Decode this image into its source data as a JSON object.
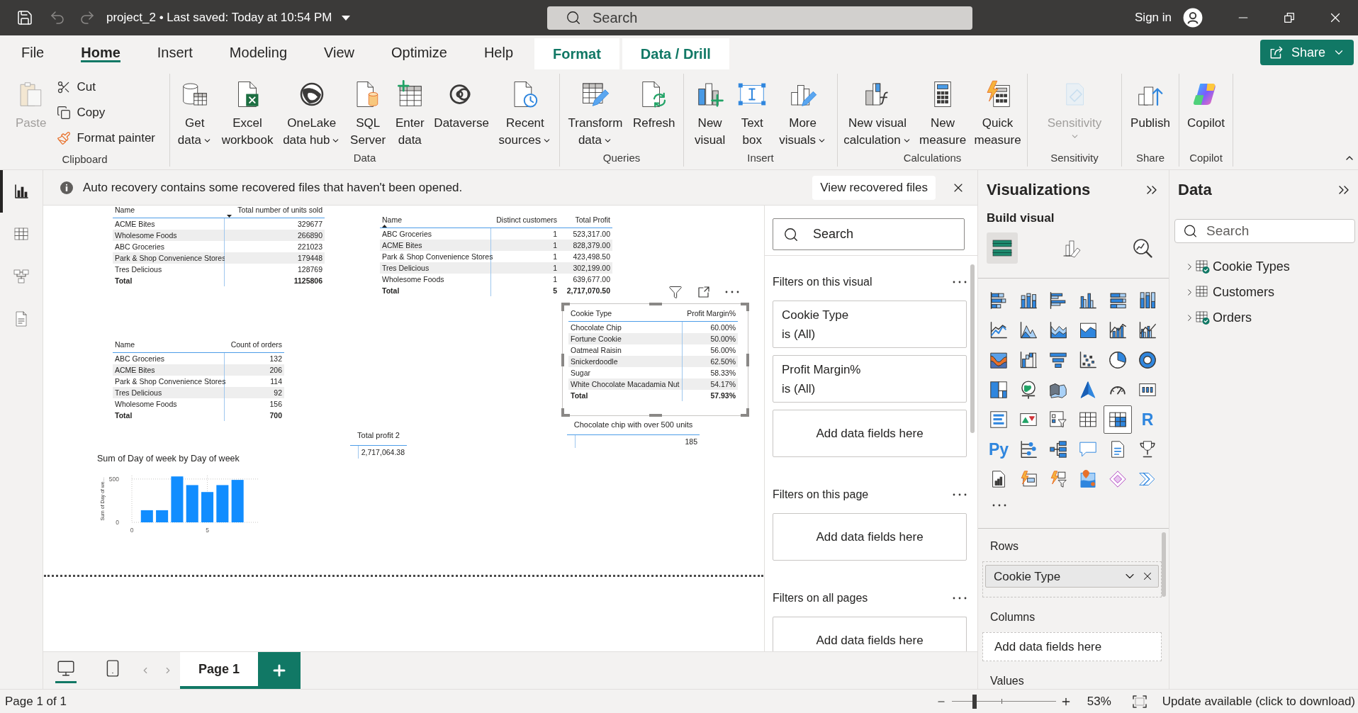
{
  "title_bar": {
    "title": "project_2 • Last saved: Today at 10:54 PM",
    "history": [
      {
        "kind": "undo",
        "disabled": true
      },
      {
        "kind": "redo",
        "disabled": true
      }
    ],
    "search": {
      "placeholder": "Search"
    },
    "sign_in": "Sign in"
  },
  "tabs": [
    {
      "label": "File",
      "selected": false,
      "contextual": false
    },
    {
      "label": "Home",
      "selected": true,
      "contextual": false
    },
    {
      "label": "Insert",
      "selected": false,
      "contextual": false
    },
    {
      "label": "Modeling",
      "selected": false,
      "contextual": false
    },
    {
      "label": "View",
      "selected": false,
      "contextual": false
    },
    {
      "label": "Optimize",
      "selected": false,
      "contextual": false
    },
    {
      "label": "Help",
      "selected": false,
      "contextual": false
    },
    {
      "label": "Format",
      "selected": false,
      "contextual": true
    },
    {
      "label": "Data / Drill",
      "selected": false,
      "contextual": true
    }
  ],
  "share_button": {
    "label": "Share"
  },
  "ribbon": [
    {
      "label": "Clipboard",
      "items": [
        {
          "kind": "large",
          "lines": [
            "Paste"
          ],
          "disabled": true,
          "dropdown": false
        },
        {
          "kind": "small",
          "lines": [
            "Cut"
          ],
          "disabled": false,
          "dropdown": false
        },
        {
          "kind": "small",
          "lines": [
            "Copy"
          ],
          "disabled": false,
          "dropdown": false
        },
        {
          "kind": "small",
          "lines": [
            "Format painter"
          ],
          "disabled": false,
          "dropdown": false
        }
      ]
    },
    {
      "label": "Data",
      "items": [
        {
          "kind": "large",
          "lines": [
            "Get",
            "data"
          ],
          "disabled": false,
          "dropdown": true
        },
        {
          "kind": "large",
          "lines": [
            "Excel",
            "workbook"
          ],
          "disabled": false,
          "dropdown": false
        },
        {
          "kind": "large",
          "lines": [
            "OneLake",
            "data hub"
          ],
          "disabled": false,
          "dropdown": true
        },
        {
          "kind": "large",
          "lines": [
            "SQL",
            "Server"
          ],
          "disabled": false,
          "dropdown": false
        },
        {
          "kind": "large",
          "lines": [
            "Enter",
            "data"
          ],
          "disabled": false,
          "dropdown": false
        },
        {
          "kind": "large",
          "lines": [
            "Dataverse"
          ],
          "disabled": false,
          "dropdown": false
        },
        {
          "kind": "large",
          "lines": [
            "Recent",
            "sources"
          ],
          "disabled": false,
          "dropdown": true
        }
      ]
    },
    {
      "label": "Queries",
      "items": [
        {
          "kind": "large",
          "lines": [
            "Transform",
            "data"
          ],
          "disabled": false,
          "dropdown": true
        },
        {
          "kind": "large",
          "lines": [
            "Refresh"
          ],
          "disabled": false,
          "dropdown": false
        }
      ]
    },
    {
      "label": "Insert",
      "items": [
        {
          "kind": "large",
          "lines": [
            "New",
            "visual"
          ],
          "disabled": false,
          "dropdown": false
        },
        {
          "kind": "large",
          "lines": [
            "Text",
            "box"
          ],
          "disabled": false,
          "dropdown": false
        },
        {
          "kind": "large",
          "lines": [
            "More",
            "visuals"
          ],
          "disabled": false,
          "dropdown": true
        }
      ]
    },
    {
      "label": "Calculations",
      "items": [
        {
          "kind": "large",
          "lines": [
            "New visual",
            "calculation"
          ],
          "disabled": false,
          "dropdown": true
        },
        {
          "kind": "large",
          "lines": [
            "New",
            "measure"
          ],
          "disabled": false,
          "dropdown": false
        },
        {
          "kind": "large",
          "lines": [
            "Quick",
            "measure"
          ],
          "disabled": false,
          "dropdown": false
        }
      ]
    },
    {
      "label": "Sensitivity",
      "items": [
        {
          "kind": "large",
          "lines": [
            "Sensitivity"
          ],
          "disabled": true,
          "dropdown": true
        }
      ]
    },
    {
      "label": "Share",
      "items": [
        {
          "kind": "large",
          "lines": [
            "Publish"
          ],
          "disabled": false,
          "dropdown": false
        }
      ]
    },
    {
      "label": "Copilot",
      "items": [
        {
          "kind": "large",
          "lines": [
            "Copilot"
          ],
          "disabled": false,
          "dropdown": false
        }
      ]
    }
  ],
  "notification": {
    "message": "Auto recovery contains some recovered files that haven't been opened.",
    "action": "View recovered files"
  },
  "left_nav": [
    {
      "selected": true
    },
    {
      "selected": false
    },
    {
      "selected": false
    },
    {
      "selected": false
    }
  ],
  "canvas": {
    "tables": [
      {
        "selected": false,
        "columns": [
          {
            "label": "Name",
            "sorted": false
          },
          {
            "label": "Total number of units sold",
            "sorted": true,
            "descending": true
          }
        ],
        "rows": [
          [
            "ACME Bites",
            "329677"
          ],
          [
            "Wholesome Foods",
            "266890"
          ],
          [
            "ABC Groceries",
            "221023"
          ],
          [
            "Park & Shop Convenience Stores",
            "179448"
          ],
          [
            "Tres Delicious",
            "128769"
          ]
        ],
        "total": [
          "Total",
          "1125806"
        ]
      },
      {
        "selected": false,
        "columns": [
          {
            "label": "Name",
            "sorted": true,
            "descending": false
          },
          {
            "label": "Distinct customers",
            "sorted": false
          },
          {
            "label": "Total Profit",
            "sorted": false
          }
        ],
        "rows": [
          [
            "ABC Groceries",
            "1",
            "523,317.00"
          ],
          [
            "ACME Bites",
            "1",
            "828,379.00"
          ],
          [
            "Park & Shop Convenience Stores",
            "1",
            "423,498.50"
          ],
          [
            "Tres Delicious",
            "1",
            "302,199.00"
          ],
          [
            "Wholesome Foods",
            "1",
            "639,677.00"
          ]
        ],
        "total": [
          "Total",
          "5",
          "2,717,070.50"
        ]
      },
      {
        "selected": false,
        "columns": [
          {
            "label": "Name",
            "sorted": false
          },
          {
            "label": "Count of orders",
            "sorted": false
          }
        ],
        "rows": [
          [
            "ABC Groceries",
            "132"
          ],
          [
            "ACME Bites",
            "206"
          ],
          [
            "Park & Shop Convenience Stores",
            "114"
          ],
          [
            "Tres Delicious",
            "92"
          ],
          [
            "Wholesome Foods",
            "156"
          ]
        ],
        "total": [
          "Total",
          "700"
        ]
      },
      {
        "selected": true,
        "columns": [
          {
            "label": "Cookie Type",
            "sorted": false
          },
          {
            "label": "Profit Margin%",
            "sorted": false
          }
        ],
        "rows": [
          [
            "Chocolate Chip",
            "60.00%"
          ],
          [
            "Fortune Cookie",
            "50.00%"
          ],
          [
            "Oatmeal Raisin",
            "56.00%"
          ],
          [
            "Snickerdoodle",
            "62.50%"
          ],
          [
            "Sugar",
            "58.33%"
          ],
          [
            "White Chocolate Macadamia Nut",
            "54.17%"
          ]
        ],
        "total": [
          "Total",
          "57.93%"
        ]
      }
    ],
    "cards": [
      {
        "label": "Total profit 2",
        "value": "2,717,064.38"
      },
      {
        "label": "Chocolate chip with over 500 units",
        "value": "185"
      }
    ],
    "chart": {
      "chart_data": {
        "type": "bar",
        "title": "Sum of Day of week by Day of week",
        "ylabel": "Sum of Day of we...",
        "x": [
          1,
          2,
          3,
          4,
          5,
          6,
          7
        ],
        "values": [
          140,
          140,
          530,
          430,
          350,
          430,
          490
        ],
        "color": "#118dff",
        "xticks": [
          0,
          5
        ],
        "yticks": [
          0,
          500
        ],
        "xlim": [
          0,
          8.4
        ],
        "ylim": [
          0,
          540
        ],
        "grid": true
      }
    }
  },
  "filters": {
    "search": {
      "placeholder": "Search"
    },
    "sections": [
      {
        "title": "Filters on this visual",
        "cards": [
          {
            "kind": "filter",
            "field": "Cookie Type",
            "condition": "is (All)"
          },
          {
            "kind": "filter",
            "field": "Profit Margin%",
            "condition": "is (All)"
          },
          {
            "kind": "drop",
            "text": "Add data fields here"
          }
        ]
      },
      {
        "title": "Filters on this page",
        "cards": [
          {
            "kind": "drop",
            "text": "Add data fields here"
          }
        ]
      },
      {
        "title": "Filters on all pages",
        "cards": [
          {
            "kind": "drop",
            "text": "Add data fields here"
          }
        ]
      }
    ]
  },
  "visualizations": {
    "title": "Visualizations",
    "subtitle": "Build visual",
    "modes": [
      {
        "selected": true
      },
      {
        "selected": false
      },
      {
        "selected": false
      }
    ],
    "gallery": [
      {
        "selected": false
      },
      {
        "selected": false
      },
      {
        "selected": false
      },
      {
        "selected": false
      },
      {
        "selected": false
      },
      {
        "selected": false
      },
      {
        "selected": false
      },
      {
        "selected": false
      },
      {
        "selected": false
      },
      {
        "selected": false
      },
      {
        "selected": false
      },
      {
        "selected": false
      },
      {
        "selected": false
      },
      {
        "selected": false
      },
      {
        "selected": false
      },
      {
        "selected": false
      },
      {
        "selected": false
      },
      {
        "selected": false
      },
      {
        "selected": false
      },
      {
        "selected": false
      },
      {
        "selected": false
      },
      {
        "selected": false
      },
      {
        "selected": false
      },
      {
        "selected": false
      },
      {
        "selected": false
      },
      {
        "selected": false
      },
      {
        "selected": false
      },
      {
        "selected": false
      },
      {
        "selected": true
      },
      {
        "selected": false,
        "glyph": "R"
      },
      {
        "selected": false,
        "glyph": "Py"
      },
      {
        "selected": false
      },
      {
        "selected": false
      },
      {
        "selected": false
      },
      {
        "selected": false
      },
      {
        "selected": false
      },
      {
        "selected": false
      },
      {
        "selected": false
      },
      {
        "selected": false
      },
      {
        "selected": false
      },
      {
        "selected": false
      },
      {
        "selected": false
      }
    ],
    "wells": [
      {
        "label": "Rows",
        "fields": [
          {
            "name": "Cookie Type"
          }
        ]
      },
      {
        "label": "Columns",
        "hint": "Add data fields here"
      },
      {
        "label": "Values"
      }
    ]
  },
  "data": {
    "title": "Data",
    "search": {
      "placeholder": "Search"
    },
    "tables": [
      {
        "name": "Cookie Types",
        "expanded": false,
        "in_use": true
      },
      {
        "name": "Customers",
        "expanded": false,
        "in_use": false
      },
      {
        "name": "Orders",
        "expanded": false,
        "in_use": true
      }
    ]
  },
  "pages": {
    "views": [
      {
        "selected": true
      },
      {
        "selected": false
      }
    ],
    "tabs": [
      {
        "label": "Page 1",
        "selected": true
      }
    ]
  },
  "status_bar": {
    "page": "Page 1 of 1",
    "zoom": {
      "level": 0.22,
      "reading": "53%"
    },
    "update": "Update available (click to download)"
  }
}
